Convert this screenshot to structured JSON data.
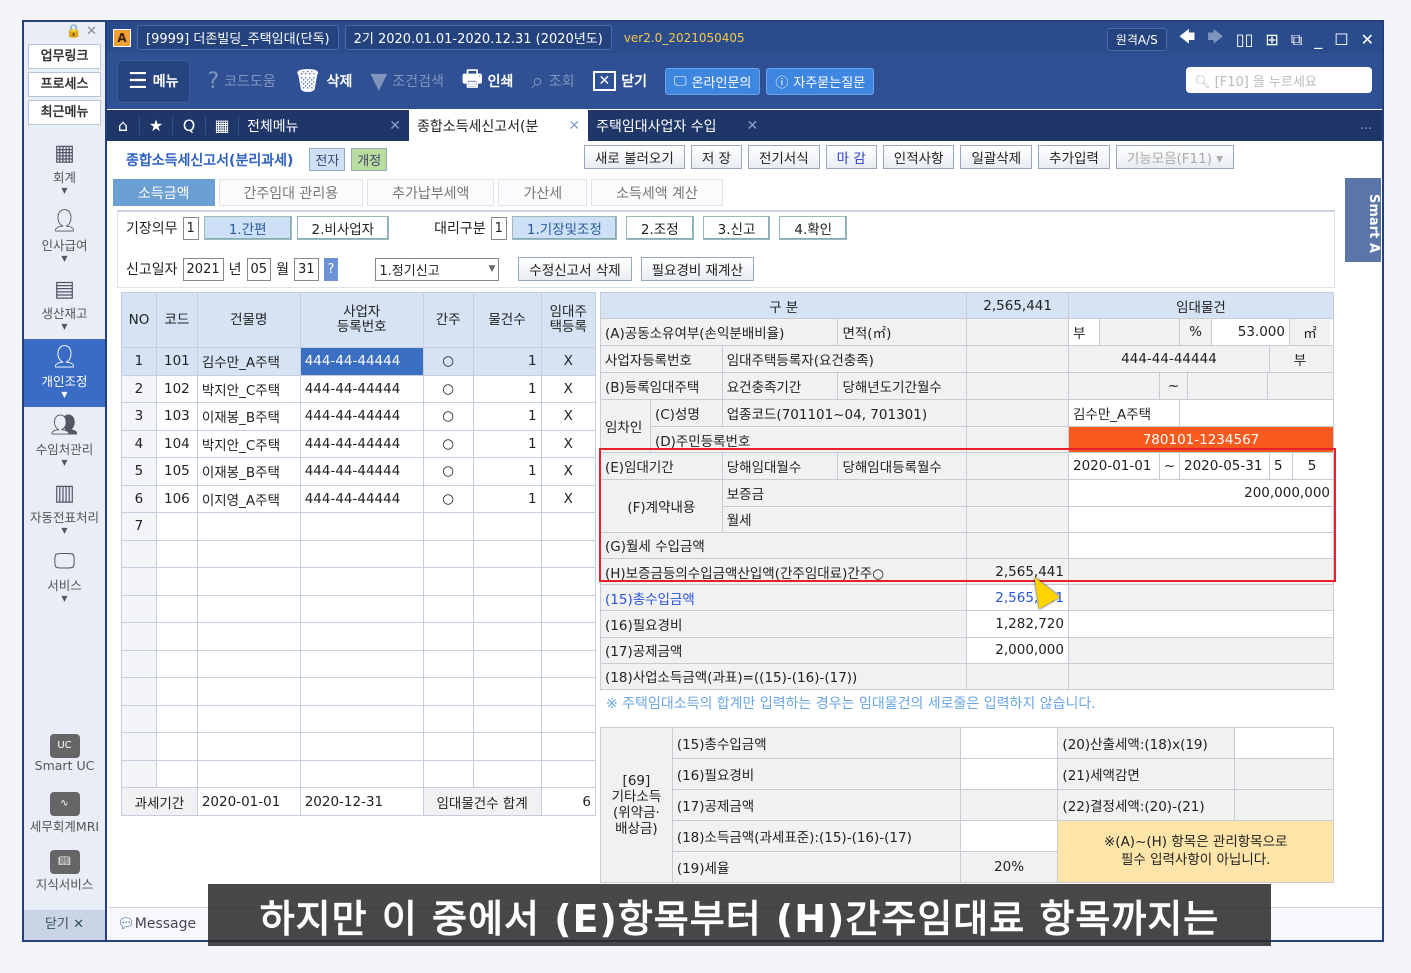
{
  "titlebar": {
    "company": "[9999] 더존빌딩_주택임대(단독)",
    "period": "2기  2020.01.01-2020.12.31  (2020년도)",
    "version": "ver2.0_2021050405",
    "remote": "원격A/S"
  },
  "toolbar": {
    "menu": "메뉴",
    "code_help": "코드도움",
    "delete": "삭제",
    "filter": "조건검색",
    "print": "인쇄",
    "lookup": "조회",
    "close": "닫기",
    "online": "온라인문의",
    "faq": "자주묻는질문",
    "search_placeholder": "[F10] 을 누르세요"
  },
  "tabs": {
    "all_menu": "전체메뉴",
    "tab1": "종합소득세신고서(분",
    "tab2": "주택임대사업자 수입",
    "more": "..."
  },
  "sidebar": {
    "top": [
      "업무링크",
      "프로세스",
      "최근메뉴"
    ],
    "nav": [
      {
        "label": "회계",
        "icon": "calculator"
      },
      {
        "label": "인사급여",
        "icon": "person"
      },
      {
        "label": "생산재고",
        "icon": "grid"
      },
      {
        "label": "개인조정",
        "icon": "user"
      },
      {
        "label": "수임처관리",
        "icon": "people"
      },
      {
        "label": "자동전표처리",
        "icon": "document"
      },
      {
        "label": "서비스",
        "icon": "monitor"
      }
    ],
    "bottom": [
      {
        "label": "Smart UC",
        "icon": "UC"
      },
      {
        "label": "세무회계MRI",
        "icon": "pulse"
      },
      {
        "label": "지식서비스",
        "icon": "book"
      }
    ],
    "close": "닫기"
  },
  "header": {
    "title": "종합소득세신고서(분리과세)",
    "badge1": "전자",
    "badge2": "개정",
    "buttons": [
      "새로 불러오기",
      "저    장",
      "전기서식",
      "마   감",
      "인적사항",
      "일괄삭제",
      "추가입력",
      "기능모음(F11) ▾"
    ],
    "smart": "Smart A"
  },
  "subtabs": [
    "소득금액",
    "간주임대 관리용",
    "추가납부세액",
    "가산세",
    "소득세액 계산"
  ],
  "form": {
    "bookkeeping_label": "기장의무",
    "bookkeeping_val": "1",
    "bk_opts": [
      "1.간편",
      "2.비사업자"
    ],
    "agent_label": "대리구분",
    "agent_val": "1",
    "agent_opts": [
      "1.기장및조정",
      "2.조정",
      "3.신고",
      "4.확인"
    ],
    "date_label": "신고일자",
    "year": "2021",
    "year_u": "년",
    "month": "05",
    "month_u": "월",
    "day": "31",
    "help": "?",
    "type": "1.정기신고",
    "del_btn": "수정신고서 삭제",
    "recalc_btn": "필요경비 재계산"
  },
  "left_table": {
    "headers": [
      "NO",
      "코드",
      "건물명",
      "사업자\n등록번호",
      "간주",
      "물건수",
      "임대주\n택등록"
    ],
    "rows": [
      [
        "1",
        "101",
        "김수만_A주택",
        "444-44-44444",
        "○",
        "1",
        "X"
      ],
      [
        "2",
        "102",
        "박지안_C주택",
        "444-44-44444",
        "○",
        "1",
        "X"
      ],
      [
        "3",
        "103",
        "이재봉_B주택",
        "444-44-44444",
        "○",
        "1",
        "X"
      ],
      [
        "4",
        "104",
        "박지안_C주택",
        "444-44-44444",
        "○",
        "1",
        "X"
      ],
      [
        "5",
        "105",
        "이재봉_B주택",
        "444-44-44444",
        "○",
        "1",
        "X"
      ],
      [
        "6",
        "106",
        "이지영_A주택",
        "444-44-44444",
        "○",
        "1",
        "X"
      ],
      [
        "7",
        "",
        "",
        "",
        "",
        "",
        ""
      ]
    ],
    "footer": {
      "label": "과세기간",
      "from": "2020-01-01",
      "to": "2020-12-31",
      "count_label": "임대물건수 합계",
      "count": "6"
    }
  },
  "right_table": {
    "h_cat": "구  분",
    "h_sum": "2,565,441",
    "h_prop": "임대물건",
    "a": "(A)공동소유여부(손익분배비율)",
    "a2": "면적(㎡)",
    "a_own": "부",
    "a_pct": "%",
    "a_area": "53.000",
    "a_unit": "㎡",
    "biz": "사업자등록번호",
    "biz2": "임대주택등록자(요건충족)",
    "biz_val": "444-44-44444",
    "biz_flag": "부",
    "b": "(B)등록임대주택",
    "b2": "요건충족기간",
    "b3": "당해년도기간월수",
    "b_tilde": "~",
    "tenant": "임차인",
    "c": "(C)성명",
    "c2": "업종코드(701101~04, 701301)",
    "c_val": "김수만_A주택",
    "d": "(D)주민등록번호",
    "d_val": "780101-1234567",
    "e": "(E)임대기간",
    "e2": "당해임대월수",
    "e3": "당해임대등록월수",
    "e_from": "2020-01-01",
    "e_tilde": "~",
    "e_to": "2020-05-31",
    "e_m1": "5",
    "e_m2": "5",
    "f": "(F)계약내용",
    "f1": "보증금",
    "f1_val": "200,000,000",
    "f2": "월세",
    "g": "(G)월세 수입금액",
    "h": "(H)보증금등의수입금액산입액(간주임대료)간주○",
    "r15": "(15)총수입금액",
    "r15_sum": "2,565,441",
    "r16": "(16)필요경비",
    "r16_sum": "1,282,720",
    "r17": "(17)공제금액",
    "r17_sum": "2,000,000",
    "r18": "(18)사업소득금액(과표)=((15)-(16)-(17))"
  },
  "note": "※ 주택임대소득의 합계만 입력하는 경우는 임대물건의 세로줄은 입력하지 않습니다.",
  "bottom_table": {
    "side": "[69]\n기타소득\n(위약금·\n배상금)",
    "r15": "(15)총수입금액",
    "r16": "(16)필요경비",
    "r17": "(17)공제금액",
    "r18": "(18)소득금액(과세표준):(15)-(16)-(17)",
    "r19": "(19)세율",
    "r19_val": "20%",
    "r20": "(20)산출세액:(18)x(19)",
    "r21": "(21)세액감면",
    "r22": "(22)결정세액:(20)-(21)",
    "notice": "※(A)~(H) 항목은 관리항목으로\n필수 입력사항이 아닙니다."
  },
  "message": "Message",
  "subtitle": "하지만 이 중에서 (E)항목부터 (H)간주임대료 항목까지는",
  "colors": {
    "navy": "#2b4c8c",
    "accent": "#3a6cc6",
    "highlight": "#fa5a1e",
    "red_box": "#e8202c"
  }
}
